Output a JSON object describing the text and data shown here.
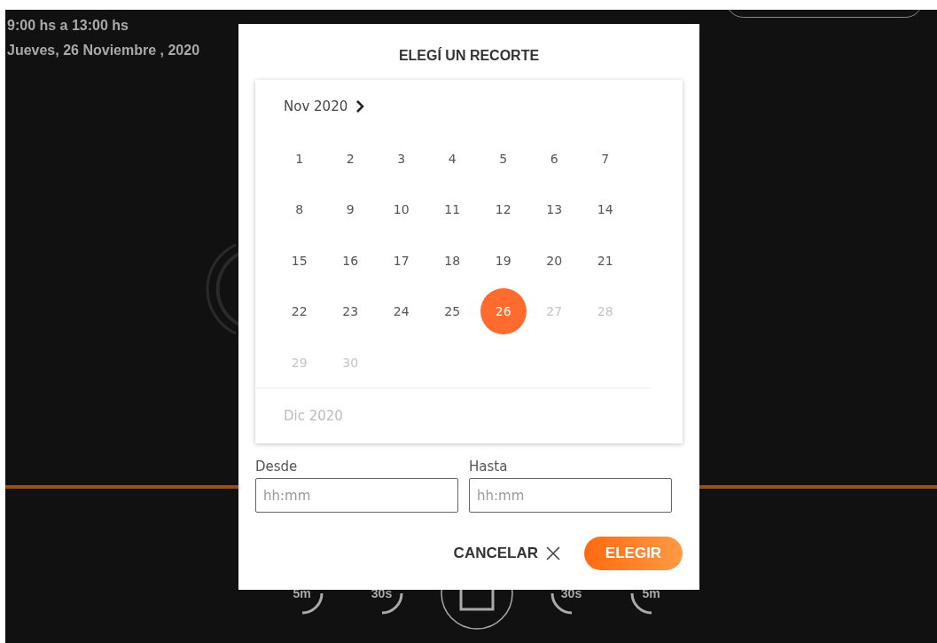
{
  "header": {
    "time_range": "9:00 hs a 13:00 hs",
    "date": "Jueves, 26 Noviembre , 2020"
  },
  "player_controls": [
    {
      "kind": "rewind",
      "label": "5m"
    },
    {
      "kind": "rewind",
      "label": "30s"
    },
    {
      "kind": "stop"
    },
    {
      "kind": "forward",
      "label": "30s"
    },
    {
      "kind": "forward",
      "label": "5m"
    }
  ],
  "dialog": {
    "title": "ELEGÍ UN RECORTE",
    "calendar": {
      "month": "Nov 2020",
      "next_month": "Dic 2020",
      "days": [
        {
          "label": "1",
          "disabled": false,
          "selected": false
        },
        {
          "label": "2",
          "disabled": false,
          "selected": false
        },
        {
          "label": "3",
          "disabled": false,
          "selected": false
        },
        {
          "label": "4",
          "disabled": false,
          "selected": false
        },
        {
          "label": "5",
          "disabled": false,
          "selected": false
        },
        {
          "label": "6",
          "disabled": false,
          "selected": false
        },
        {
          "label": "7",
          "disabled": false,
          "selected": false
        },
        {
          "label": "8",
          "disabled": false,
          "selected": false
        },
        {
          "label": "9",
          "disabled": false,
          "selected": false
        },
        {
          "label": "10",
          "disabled": false,
          "selected": false
        },
        {
          "label": "11",
          "disabled": false,
          "selected": false
        },
        {
          "label": "12",
          "disabled": false,
          "selected": false
        },
        {
          "label": "13",
          "disabled": false,
          "selected": false
        },
        {
          "label": "14",
          "disabled": false,
          "selected": false
        },
        {
          "label": "15",
          "disabled": false,
          "selected": false
        },
        {
          "label": "16",
          "disabled": false,
          "selected": false
        },
        {
          "label": "17",
          "disabled": false,
          "selected": false
        },
        {
          "label": "18",
          "disabled": false,
          "selected": false
        },
        {
          "label": "19",
          "disabled": false,
          "selected": false
        },
        {
          "label": "20",
          "disabled": false,
          "selected": false
        },
        {
          "label": "21",
          "disabled": false,
          "selected": false
        },
        {
          "label": "22",
          "disabled": false,
          "selected": false
        },
        {
          "label": "23",
          "disabled": false,
          "selected": false
        },
        {
          "label": "24",
          "disabled": false,
          "selected": false
        },
        {
          "label": "25",
          "disabled": false,
          "selected": false
        },
        {
          "label": "26",
          "disabled": false,
          "selected": true
        },
        {
          "label": "27",
          "disabled": true,
          "selected": false
        },
        {
          "label": "28",
          "disabled": true,
          "selected": false
        },
        {
          "label": "29",
          "disabled": true,
          "selected": false
        },
        {
          "label": "30",
          "disabled": true,
          "selected": false
        }
      ]
    },
    "fields": [
      {
        "label": "Desde",
        "placeholder": "hh:mm"
      },
      {
        "label": "Hasta",
        "placeholder": "hh:mm"
      }
    ],
    "buttons": [
      {
        "kind": "cancel",
        "label": "CANCELAR"
      },
      {
        "kind": "primary",
        "label": "ELEGIR"
      }
    ]
  }
}
